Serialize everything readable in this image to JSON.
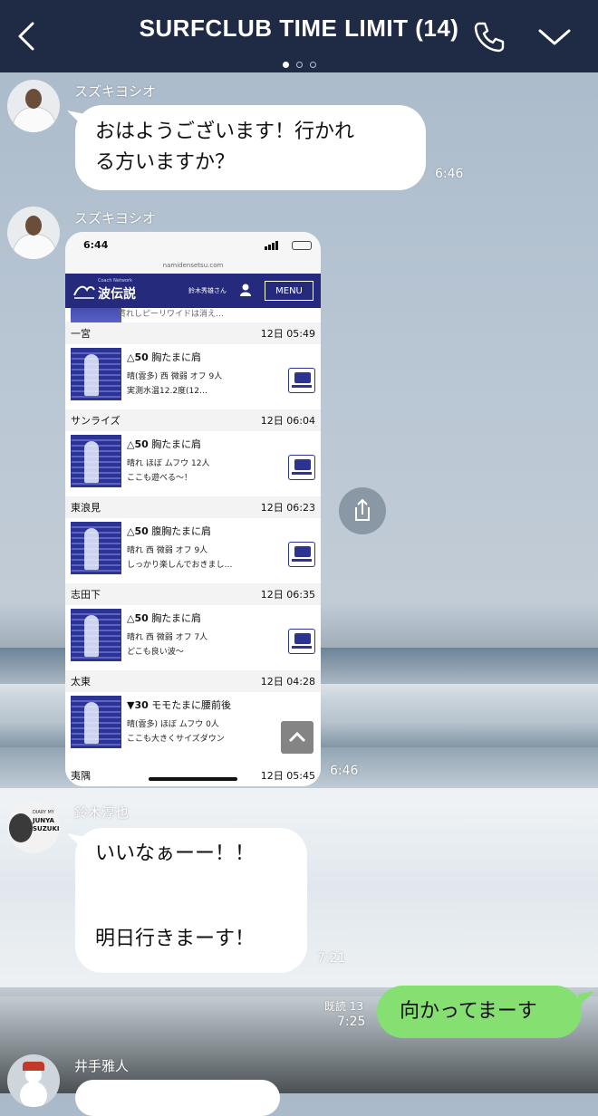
{
  "header": {
    "title": "SURFCLUB  TIME LIMIT (14)",
    "page_dots": 3,
    "active_dot": 0
  },
  "messages": [
    {
      "sender": "スズキヨシオ",
      "text_lines": [
        "おはようございます！行かれ",
        "る方いますか？"
      ],
      "time": "6:46"
    },
    {
      "sender": "スズキヨシオ",
      "type": "image",
      "time": "6:46"
    },
    {
      "sender": "鈴木淳也",
      "text_lines": [
        "いいなぁーー！！",
        "",
        "",
        "明日行きまーす！"
      ],
      "time": "7:21"
    },
    {
      "mine": true,
      "text": "向かってまーす",
      "read": "既読 13",
      "time": "7:25"
    },
    {
      "sender": "井手雅人"
    }
  ],
  "avatar_jsuzuki": {
    "line1": "DIARY MY",
    "line2": "JUNYA",
    "line3": "SUZUKI"
  },
  "screenshot": {
    "status_time": "6:44",
    "url": "namidensetsu.com",
    "brand_small": "Coach Network",
    "brand": "波伝説",
    "user": "鈴木秀雄さん",
    "menu": "MENU",
    "cut_text": "貫れしピーリワイドは消え…",
    "spots": [
      {
        "name": "一宮",
        "time": "12日 05:49",
        "mark": "△",
        "size_num": "50",
        "size_text": " 胸たまに肩",
        "cond": "晴(雲多) 西 微弱 オフ 9人",
        "note": "実測水温12.2度(12…"
      },
      {
        "name": "サンライズ",
        "time": "12日 06:04",
        "mark": "△",
        "size_num": "50",
        "size_text": " 胸たまに肩",
        "cond": "晴れ ほぼ ムフウ 12人",
        "note": "ここも遊べる〜！"
      },
      {
        "name": "東浪見",
        "time": "12日 06:23",
        "mark": "△",
        "size_num": "50",
        "size_text": " 腹胸たまに肩",
        "cond": "晴れ 西 微弱 オフ 9人",
        "note": "しっかり楽しんでおきまし…"
      },
      {
        "name": "志田下",
        "time": "12日 06:35",
        "mark": "△",
        "size_num": "50",
        "size_text": " 胸たまに肩",
        "cond": "晴れ 西 微弱 オフ 7人",
        "note": "どこも良い波〜"
      },
      {
        "name": "太東",
        "time": "12日 04:28",
        "mark": "▼",
        "size_num": "30",
        "size_text": " モモたまに腰前後",
        "cond": "晴(雲多) ほぼ ムフウ 0人",
        "note": "ここも大きくサイズダウン"
      }
    ],
    "bottom_spot": {
      "name": "夷隅",
      "time": "12日 05:45"
    }
  }
}
